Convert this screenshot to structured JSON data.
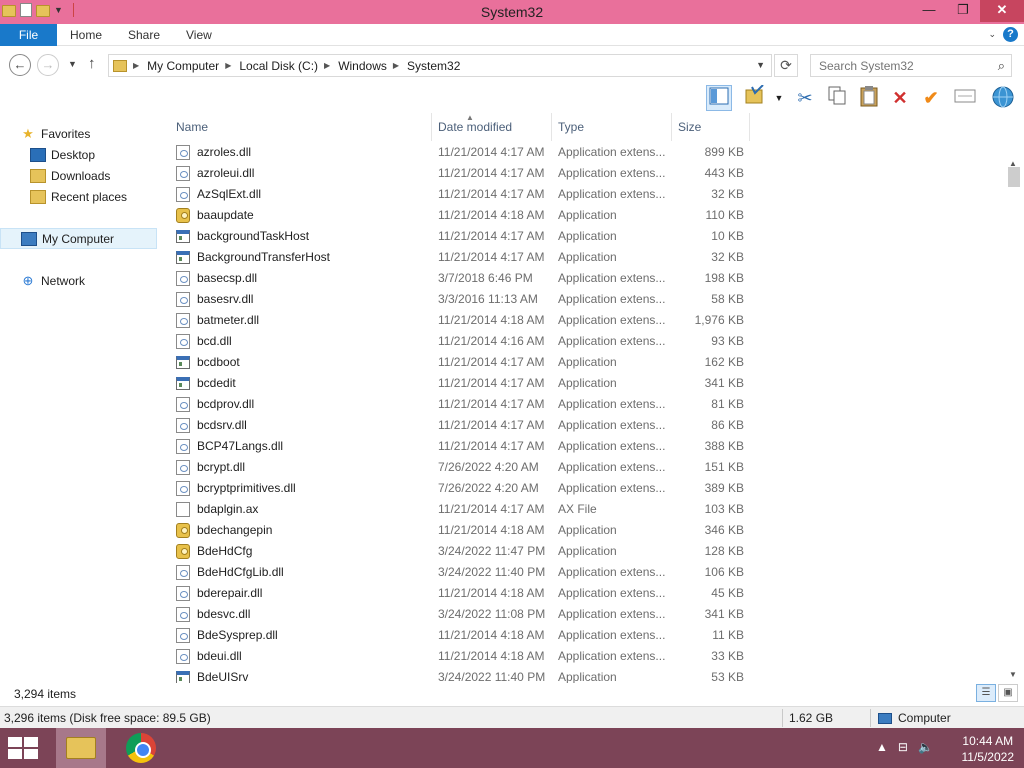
{
  "window": {
    "title": "System32",
    "minimize": "—",
    "maximize": "❐",
    "close": "✕"
  },
  "ribbon": {
    "tabs": [
      "File",
      "Home",
      "Share",
      "View"
    ],
    "help": "?"
  },
  "address": {
    "crumbs": [
      "My Computer",
      "Local Disk (C:)",
      "Windows",
      "System32"
    ],
    "search_placeholder": "Search System32"
  },
  "nav": {
    "favorites": "Favorites",
    "desktop": "Desktop",
    "downloads": "Downloads",
    "recent": "Recent places",
    "computer": "My Computer",
    "network": "Network"
  },
  "columns": {
    "name": "Name",
    "date": "Date modified",
    "type": "Type",
    "size": "Size"
  },
  "files": [
    {
      "name": "azroles.dll",
      "date": "11/21/2014 4:17 AM",
      "type": "Application extens...",
      "size": "899 KB",
      "icon": "dll"
    },
    {
      "name": "azroleui.dll",
      "date": "11/21/2014 4:17 AM",
      "type": "Application extens...",
      "size": "443 KB",
      "icon": "dll"
    },
    {
      "name": "AzSqlExt.dll",
      "date": "11/21/2014 4:17 AM",
      "type": "Application extens...",
      "size": "32 KB",
      "icon": "dll"
    },
    {
      "name": "baaupdate",
      "date": "11/21/2014 4:18 AM",
      "type": "Application",
      "size": "110 KB",
      "icon": "keys"
    },
    {
      "name": "backgroundTaskHost",
      "date": "11/21/2014 4:17 AM",
      "type": "Application",
      "size": "10 KB",
      "icon": "exe"
    },
    {
      "name": "BackgroundTransferHost",
      "date": "11/21/2014 4:17 AM",
      "type": "Application",
      "size": "32 KB",
      "icon": "exe"
    },
    {
      "name": "basecsp.dll",
      "date": "3/7/2018 6:46 PM",
      "type": "Application extens...",
      "size": "198 KB",
      "icon": "dll"
    },
    {
      "name": "basesrv.dll",
      "date": "3/3/2016 11:13 AM",
      "type": "Application extens...",
      "size": "58 KB",
      "icon": "dll"
    },
    {
      "name": "batmeter.dll",
      "date": "11/21/2014 4:18 AM",
      "type": "Application extens...",
      "size": "1,976 KB",
      "icon": "dll"
    },
    {
      "name": "bcd.dll",
      "date": "11/21/2014 4:16 AM",
      "type": "Application extens...",
      "size": "93 KB",
      "icon": "dll"
    },
    {
      "name": "bcdboot",
      "date": "11/21/2014 4:17 AM",
      "type": "Application",
      "size": "162 KB",
      "icon": "exe"
    },
    {
      "name": "bcdedit",
      "date": "11/21/2014 4:17 AM",
      "type": "Application",
      "size": "341 KB",
      "icon": "exe"
    },
    {
      "name": "bcdprov.dll",
      "date": "11/21/2014 4:17 AM",
      "type": "Application extens...",
      "size": "81 KB",
      "icon": "dll"
    },
    {
      "name": "bcdsrv.dll",
      "date": "11/21/2014 4:17 AM",
      "type": "Application extens...",
      "size": "86 KB",
      "icon": "dll"
    },
    {
      "name": "BCP47Langs.dll",
      "date": "11/21/2014 4:17 AM",
      "type": "Application extens...",
      "size": "388 KB",
      "icon": "dll"
    },
    {
      "name": "bcrypt.dll",
      "date": "7/26/2022 4:20 AM",
      "type": "Application extens...",
      "size": "151 KB",
      "icon": "dll"
    },
    {
      "name": "bcryptprimitives.dll",
      "date": "7/26/2022 4:20 AM",
      "type": "Application extens...",
      "size": "389 KB",
      "icon": "dll"
    },
    {
      "name": "bdaplgin.ax",
      "date": "11/21/2014 4:17 AM",
      "type": "AX File",
      "size": "103 KB",
      "icon": "blank"
    },
    {
      "name": "bdechangepin",
      "date": "11/21/2014 4:18 AM",
      "type": "Application",
      "size": "346 KB",
      "icon": "keys"
    },
    {
      "name": "BdeHdCfg",
      "date": "3/24/2022 11:47 PM",
      "type": "Application",
      "size": "128 KB",
      "icon": "keys"
    },
    {
      "name": "BdeHdCfgLib.dll",
      "date": "3/24/2022 11:40 PM",
      "type": "Application extens...",
      "size": "106 KB",
      "icon": "dll"
    },
    {
      "name": "bderepair.dll",
      "date": "11/21/2014 4:18 AM",
      "type": "Application extens...",
      "size": "45 KB",
      "icon": "dll"
    },
    {
      "name": "bdesvc.dll",
      "date": "3/24/2022 11:08 PM",
      "type": "Application extens...",
      "size": "341 KB",
      "icon": "dll"
    },
    {
      "name": "BdeSysprep.dll",
      "date": "11/21/2014 4:18 AM",
      "type": "Application extens...",
      "size": "11 KB",
      "icon": "dll"
    },
    {
      "name": "bdeui.dll",
      "date": "11/21/2014 4:18 AM",
      "type": "Application extens...",
      "size": "33 KB",
      "icon": "dll"
    },
    {
      "name": "BdeUISrv",
      "date": "3/24/2022 11:40 PM",
      "type": "Application",
      "size": "53 KB",
      "icon": "exe"
    }
  ],
  "status": {
    "item_count": "3,294 items",
    "summary": "3,296 items (Disk free space: 89.5 GB)",
    "size": "1.62 GB",
    "location": "Computer"
  },
  "taskbar": {
    "time": "10:44 AM",
    "date": "11/5/2022"
  }
}
